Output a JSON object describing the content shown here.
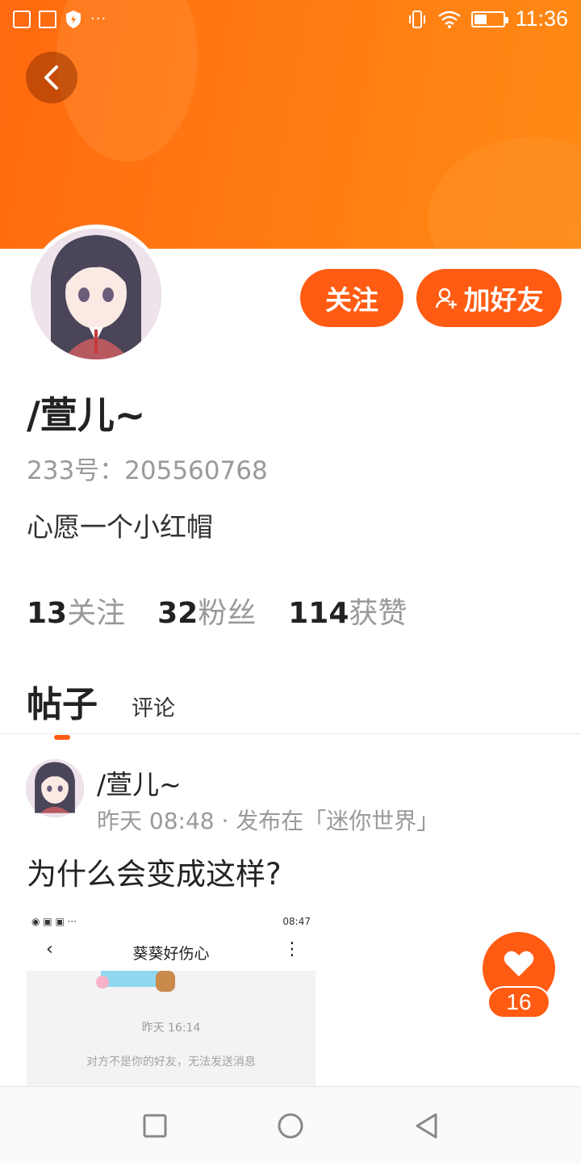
{
  "status_bar": {
    "time": "11:36",
    "battery_level": 0.45,
    "left_icons": [
      "sim-card-icon",
      "image-icon",
      "shield-icon"
    ],
    "overflow": "···"
  },
  "profile": {
    "username": "/萱儿~",
    "uid_line": "233号：205560768",
    "bio": "心愿一个小红帽",
    "follow_label": "关注",
    "add_friend_label": "加好友"
  },
  "stats": [
    {
      "num": "13",
      "label": "关注"
    },
    {
      "num": "32",
      "label": "粉丝"
    },
    {
      "num": "114",
      "label": "获赞"
    }
  ],
  "tabs": {
    "posts": "帖子",
    "comments": "评论"
  },
  "post": {
    "author": "/萱儿~",
    "meta": "昨天 08:48 · 发布在「迷你世界」",
    "title": "为什么会变成这样?",
    "likes": "16",
    "screenshot": {
      "time": "08:47",
      "title": "葵葵好伤心",
      "msg_time": "昨天 16:14",
      "notice": "对方不是你的好友，无法发送消息"
    }
  },
  "colors": {
    "accent": "#ff5b12",
    "banner": "#ff7a12"
  }
}
